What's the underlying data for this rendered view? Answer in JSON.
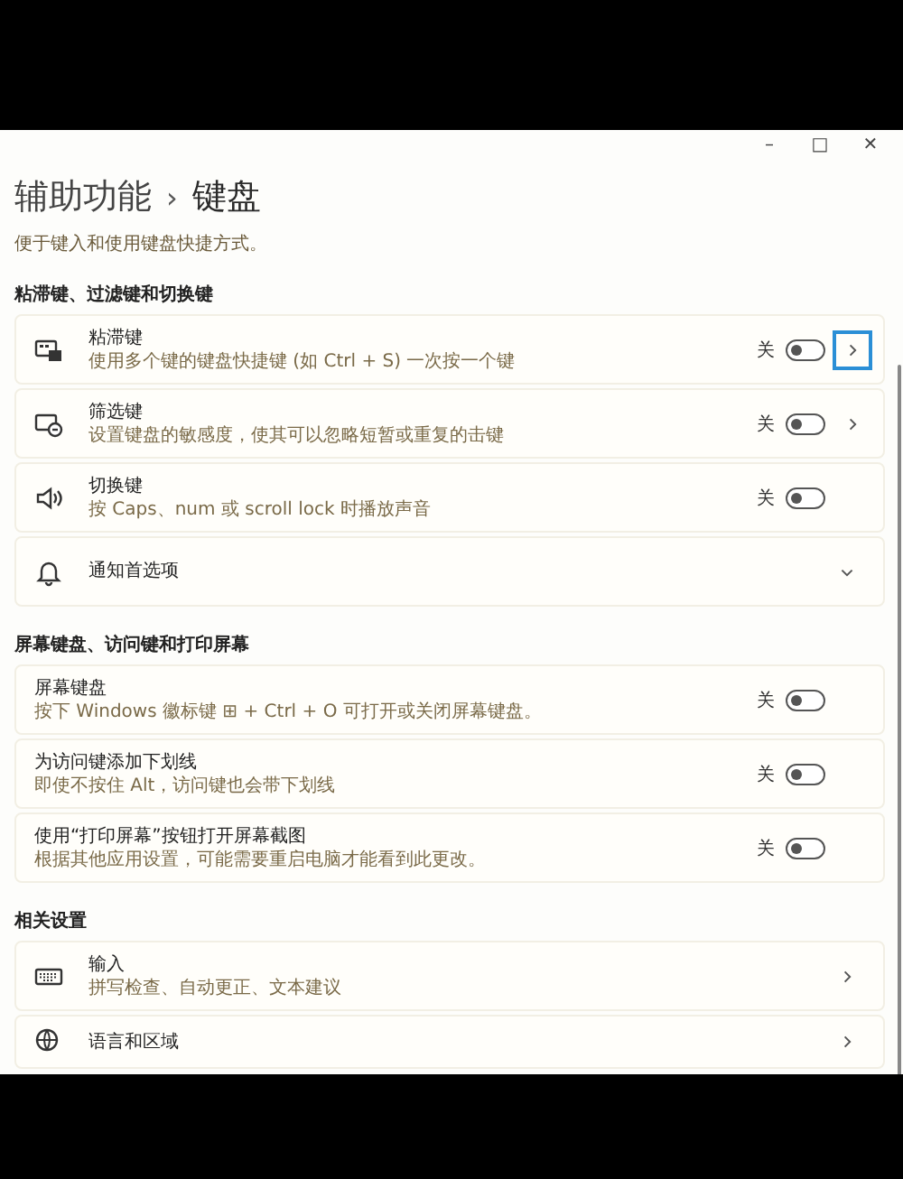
{
  "window": {
    "controls": [
      "–",
      "□",
      "✕"
    ]
  },
  "breadcrumb": {
    "parent": "辅助功能",
    "separator": "›",
    "current": "键盘"
  },
  "description": "便于键入和使用键盘快捷方式。",
  "sections": [
    {
      "title": "粘滞键、过滤键和切换键",
      "items": [
        {
          "kind": "toggle",
          "title": "粘滞键",
          "subtitle": "使用多个键的键盘快捷键 (如 Ctrl + S) 一次按一个键",
          "state_label": "关",
          "on": false,
          "chevron": true,
          "focused": true
        },
        {
          "kind": "toggle",
          "title": "筛选键",
          "subtitle": "设置键盘的敏感度，使其可以忽略短暂或重复的击键",
          "state_label": "关",
          "on": false,
          "chevron": true,
          "focused": false
        },
        {
          "kind": "toggle",
          "title": "切换键",
          "subtitle": "按 Caps、num 或 scroll lock 时播放声音",
          "state_label": "关",
          "on": false
        },
        {
          "kind": "expand",
          "title": "通知首选项",
          "expanded": false
        }
      ]
    },
    {
      "title": "屏幕键盘、访问键和打印屏幕",
      "items": [
        {
          "kind": "toggle",
          "title": "屏幕键盘",
          "subtitle": "按下 Windows 徽标键 ⊞ + Ctrl + O 可打开或关闭屏幕键盘。",
          "state_label": "关",
          "on": false
        },
        {
          "kind": "toggle",
          "title": "为访问键添加下划线",
          "subtitle": "即使不按住 Alt，访问键也会带下划线",
          "state_label": "关",
          "on": false
        },
        {
          "kind": "toggle",
          "title": "使用“打印屏幕”按钮打开屏幕截图",
          "subtitle": "根据其他应用设置，可能需要重启电脑才能看到此更改。",
          "state_label": "关",
          "on": false
        }
      ]
    },
    {
      "title": "相关设置",
      "items": [
        {
          "kind": "link",
          "title": "输入",
          "subtitle": "拼写检查、自动更正、文本建议"
        },
        {
          "kind": "link",
          "title": "语言和区域"
        }
      ]
    }
  ]
}
